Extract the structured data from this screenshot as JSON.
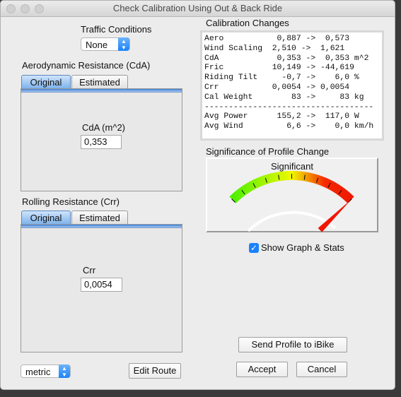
{
  "window": {
    "title": "Check Calibration Using Out & Back Ride"
  },
  "traffic": {
    "label": "Traffic Conditions",
    "value": "None"
  },
  "aero": {
    "label": "Aerodynamic Resistance (CdA)",
    "tabs": [
      "Original",
      "Estimated"
    ],
    "field_label": "CdA (m^2)",
    "value": "0,353"
  },
  "rolling": {
    "label": "Rolling Resistance (Crr)",
    "tabs": [
      "Original",
      "Estimated"
    ],
    "field_label": "Crr",
    "value": "0,0054"
  },
  "units": {
    "value": "metric"
  },
  "buttons": {
    "edit_route": "Edit Route",
    "send_profile": "Send Profile to iBike",
    "accept": "Accept",
    "cancel": "Cancel"
  },
  "calibration": {
    "label": "Calibration Changes",
    "text": "Aero           0,887 ->  0,573\nWind Scaling  2,510 ->  1,621\nCdA            0,353 ->  0,353 m^2\nFric          10,149 -> -44,619\nRiding Tilt     -0,7 ->    6,0 %\nCrr           0,0054 -> 0,0054\nCal Weight        83 ->     83 kg\n-----------------------------------\nAvg Power      155,2 ->  117,0 W\nAvg Wind         6,6 ->    0,0 km/h"
  },
  "significance": {
    "label": "Significance of Profile Change",
    "status": "Significant",
    "level": 1.0
  },
  "show_graph": {
    "label": "Show Graph & Stats",
    "checked": true
  }
}
